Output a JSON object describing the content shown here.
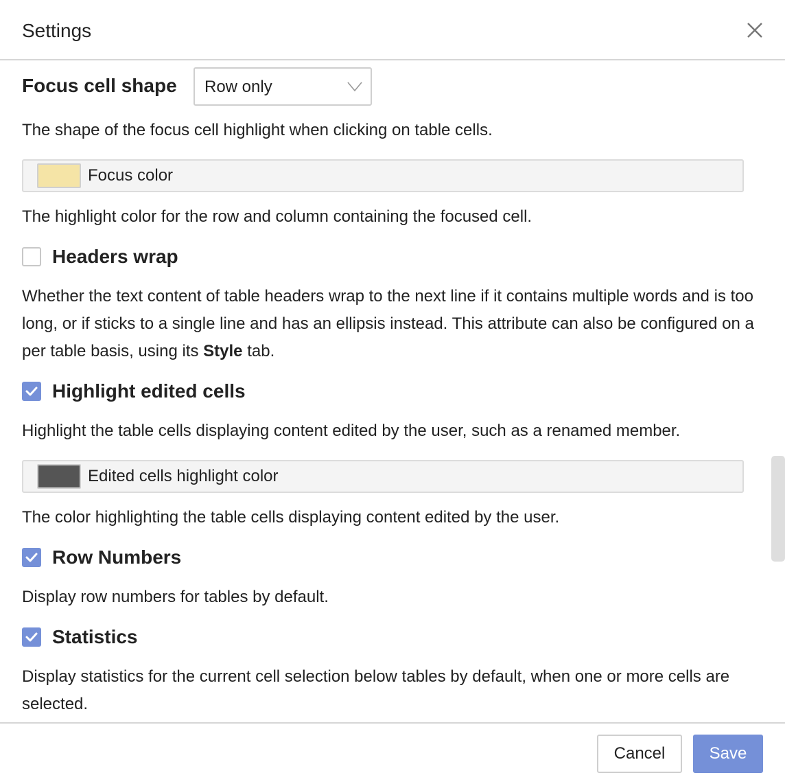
{
  "dialog": {
    "title": "Settings",
    "close_icon": "close-icon"
  },
  "settings": {
    "focus_cell_shape": {
      "label": "Focus cell shape",
      "selected": "Row only",
      "description": "The shape of the focus cell highlight when clicking on table cells."
    },
    "focus_color": {
      "label": "Focus color",
      "swatch": "#f5e4a6",
      "description": "The highlight color for the row and column containing the focused cell."
    },
    "headers_wrap": {
      "label": "Headers wrap",
      "checked": false,
      "description_before": "Whether the text content of table headers wrap to the next line if it contains multiple words and is too long, or if sticks to a single line and has an ellipsis instead. This attribute can also be configured on a per table basis, using its",
      "description_bold": "Style",
      "description_after": "tab."
    },
    "highlight_edited_cells": {
      "label": "Highlight edited cells",
      "checked": true,
      "description": "Highlight the table cells displaying content edited by the user, such as a renamed member."
    },
    "edited_cells_color": {
      "label": "Edited cells highlight color",
      "swatch": "#555555",
      "description": "The color highlighting the table cells displaying content edited by the user."
    },
    "row_numbers": {
      "label": "Row Numbers",
      "checked": true,
      "description": "Display row numbers for tables by default."
    },
    "statistics": {
      "label": "Statistics",
      "checked": true,
      "description_line1": "Display statistics for the current cell selection below tables by default, when one or more cells are",
      "description_line2": "selected."
    }
  },
  "footer": {
    "cancel_label": "Cancel",
    "save_label": "Save"
  },
  "colors": {
    "accent": "#7590d8",
    "border": "#d6d6d6",
    "text": "#222222"
  }
}
